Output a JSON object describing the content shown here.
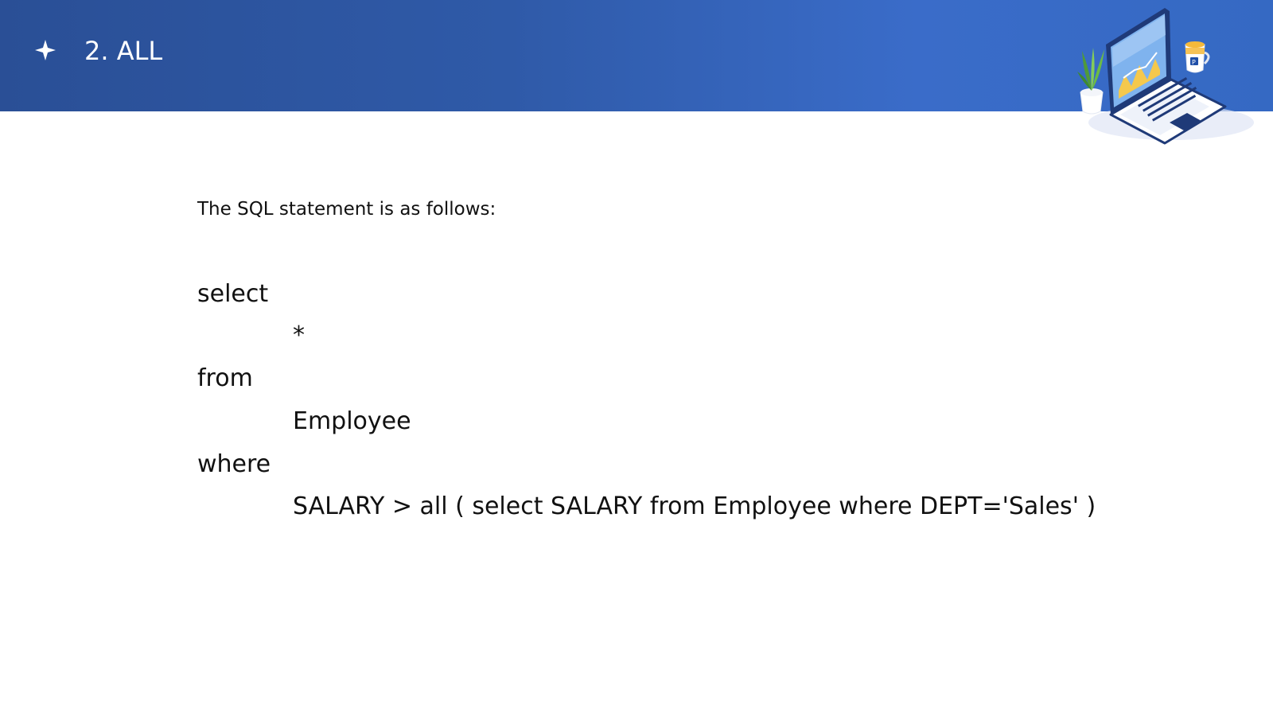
{
  "header": {
    "title": "2. ALL",
    "star_icon": "four-point-star-icon",
    "illustration": "laptop-chart-illustration",
    "accent_color": "#2f5aa8"
  },
  "content": {
    "intro": "The SQL statement is as follows:",
    "sql": {
      "select_kw": "select",
      "select_expr": "*",
      "from_kw": "from",
      "from_expr": "Employee",
      "where_kw": "where",
      "where_expr": "SALARY > all ( select SALARY from Employee where DEPT='Sales' )"
    }
  }
}
